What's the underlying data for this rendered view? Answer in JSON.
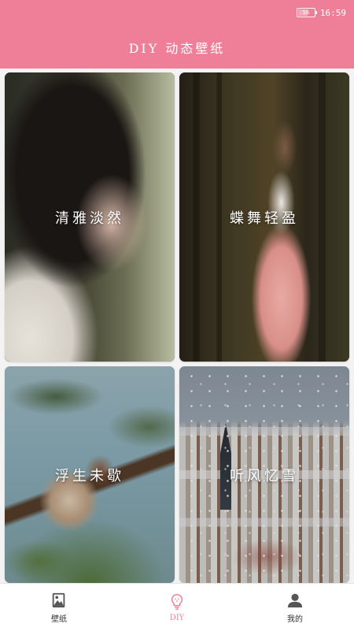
{
  "status_bar": {
    "battery": "56",
    "time": "16:59"
  },
  "header": {
    "title": "DIY 动态壁纸"
  },
  "cards": [
    {
      "label": "清雅淡然"
    },
    {
      "label": "蝶舞轻盈"
    },
    {
      "label": "浮生未歇"
    },
    {
      "label": "听风忆雪"
    }
  ],
  "nav": {
    "items": [
      {
        "label": "壁纸",
        "icon": "wallpaper-icon"
      },
      {
        "label": "DIY",
        "icon": "bulb-icon",
        "active": true
      },
      {
        "label": "我的",
        "icon": "user-icon"
      }
    ]
  },
  "colors": {
    "accent": "#ef7e98",
    "background": "#f3f3f3",
    "nav_background": "#ffffff"
  }
}
